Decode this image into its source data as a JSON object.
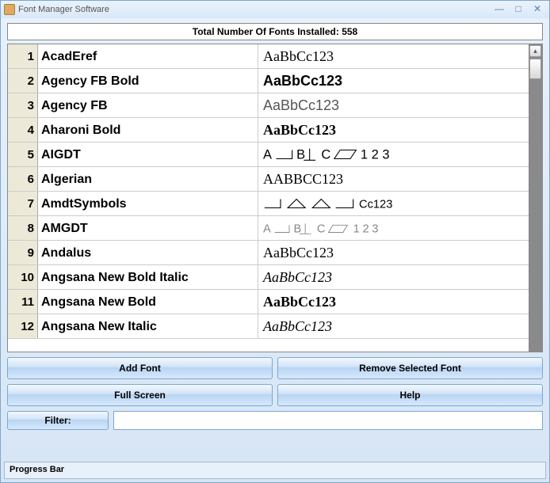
{
  "window": {
    "title": "Font Manager Software"
  },
  "summary": "Total Number Of Fonts Installed: 558",
  "fonts": [
    {
      "n": "1",
      "name": "AcadEref",
      "preview": "AaBbCc123",
      "cls": "pv-serif"
    },
    {
      "n": "2",
      "name": "Agency FB Bold",
      "preview": "AaBbCc123",
      "cls": "pv-narrow"
    },
    {
      "n": "3",
      "name": "Agency FB",
      "preview": "AaBbCc123",
      "cls": "pv-narrow2"
    },
    {
      "n": "4",
      "name": "Aharoni Bold",
      "preview": "AaBbCc123",
      "cls": "pv-boldserif"
    },
    {
      "n": "5",
      "name": "AIGDT",
      "preview": "",
      "cls": "pv-svg",
      "svg": "aigdt"
    },
    {
      "n": "6",
      "name": "Algerian",
      "preview": "AABBCC123",
      "cls": "pv-smallcaps"
    },
    {
      "n": "7",
      "name": "AmdtSymbols",
      "preview": "",
      "cls": "pv-svg",
      "svg": "amdt"
    },
    {
      "n": "8",
      "name": "AMGDT",
      "preview": "",
      "cls": "pv-svg",
      "svg": "amgdt"
    },
    {
      "n": "9",
      "name": "Andalus",
      "preview": "AaBbCc123",
      "cls": "pv-serif"
    },
    {
      "n": "10",
      "name": "Angsana New Bold Italic",
      "preview": "AaBbCc123",
      "cls": "pv-italic"
    },
    {
      "n": "11",
      "name": "Angsana New Bold",
      "preview": "AaBbCc123",
      "cls": "pv-serif14b"
    },
    {
      "n": "12",
      "name": "Angsana New Italic",
      "preview": "AaBbCc123",
      "cls": "pv-italic"
    }
  ],
  "buttons": {
    "add": "Add Font",
    "remove": "Remove Selected Font",
    "fullscreen": "Full Screen",
    "help": "Help"
  },
  "filter": {
    "label": "Filter:",
    "value": ""
  },
  "status": "Progress Bar"
}
